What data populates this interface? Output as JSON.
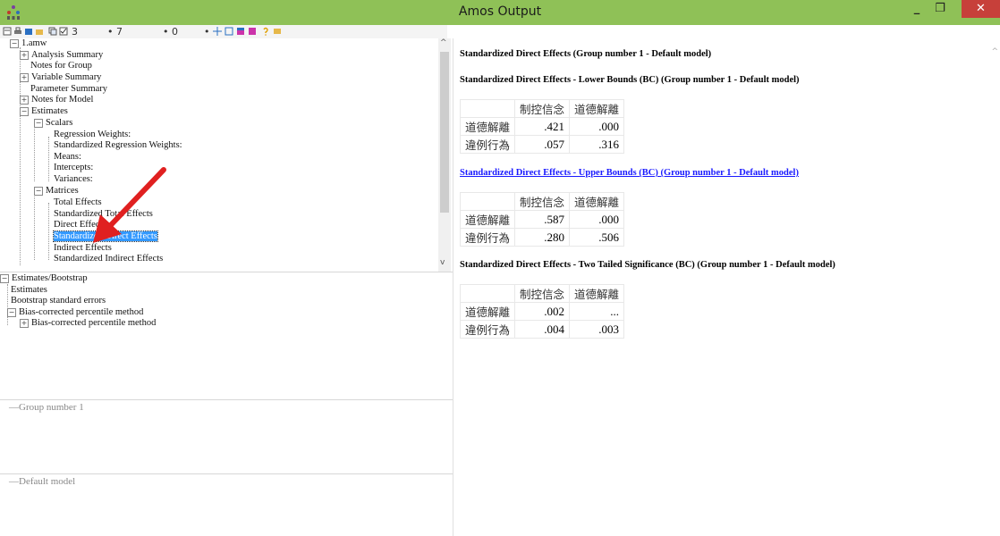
{
  "window": {
    "title": "Amos Output"
  },
  "toolbar": {
    "spin1": "3",
    "spin2": "7",
    "spin3": "0"
  },
  "tree": {
    "root": "1.amw",
    "analysis_summary": "Analysis Summary",
    "notes_for_group": "Notes for Group",
    "variable_summary": "Variable Summary",
    "parameter_summary": "Parameter Summary",
    "notes_for_model": "Notes for Model",
    "estimates": "Estimates",
    "scalars": "Scalars",
    "regression_weights": "Regression Weights:",
    "std_regression_weights": "Standardized Regression Weights:",
    "means": "Means:",
    "intercepts": "Intercepts:",
    "variances": "Variances:",
    "matrices": "Matrices",
    "total_effects": "Total Effects",
    "std_total_effects": "Standardized Total Effects",
    "direct_effects": "Direct Effects",
    "std_direct_effects": "Standardized Direct Effects",
    "indirect_effects": "Indirect Effects",
    "std_indirect_effects": "Standardized Indirect Effects"
  },
  "tree2": {
    "estimates_bootstrap": "Estimates/Bootstrap",
    "estimates": "Estimates",
    "bootstrap_se": "Bootstrap standard errors",
    "bias_corrected": "Bias-corrected percentile method",
    "bias_corrected_child": "Bias-corrected percentile method"
  },
  "panels": {
    "group": "Group number 1",
    "model": "Default model"
  },
  "output": {
    "heading_main": "Standardized Direct Effects (Group number 1 - Default model)",
    "sections": [
      {
        "heading": "Standardized Direct Effects - Lower Bounds (BC) (Group number 1 - Default model)",
        "columns": [
          "制控信念",
          "道德解離"
        ],
        "rows": [
          {
            "label": "道德解離",
            "values": [
              ".421",
              ".000"
            ]
          },
          {
            "label": "違例行為",
            "values": [
              ".057",
              ".316"
            ]
          }
        ]
      },
      {
        "heading": "Standardized Direct Effects - Upper Bounds (BC) (Group number 1 - Default model)",
        "columns": [
          "制控信念",
          "道德解離"
        ],
        "rows": [
          {
            "label": "道德解離",
            "values": [
              ".587",
              ".000"
            ]
          },
          {
            "label": "違例行為",
            "values": [
              ".280",
              ".506"
            ]
          }
        ]
      },
      {
        "heading": "Standardized Direct Effects - Two Tailed Significance (BC) (Group number 1 - Default model)",
        "columns": [
          "制控信念",
          "道德解離"
        ],
        "rows": [
          {
            "label": "道德解離",
            "values": [
              ".002",
              "..."
            ]
          },
          {
            "label": "違例行為",
            "values": [
              ".004",
              ".003"
            ]
          }
        ]
      }
    ]
  },
  "colors": {
    "titlebar": "#8fc157",
    "selection": "#3399ff",
    "link": "#1a1aff",
    "arrow": "#e02020",
    "close": "#c7403a"
  }
}
